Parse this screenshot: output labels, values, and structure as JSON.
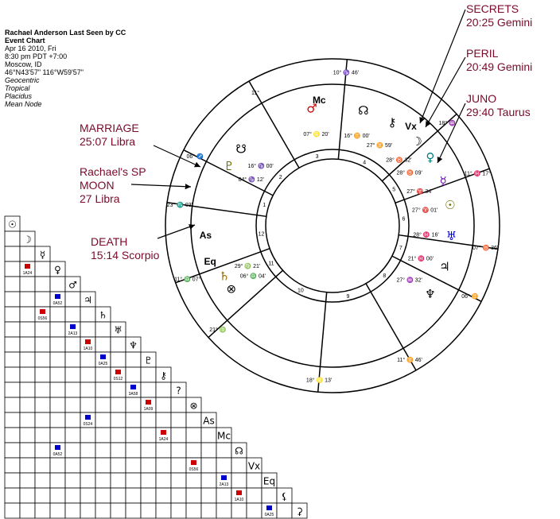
{
  "header": {
    "title": "Rachael Anderson Last Seen by CC",
    "chart_type": "Event Chart",
    "date": "Apr 16 2010, Fri",
    "time": "8:30 pm  PDT +7:00",
    "place": "Moscow, ID",
    "coords": "46°N43'57\"  116°W59'57\"",
    "settings": [
      "Geocentric",
      "Tropical",
      "Placidus",
      "Mean Node"
    ]
  },
  "annotations": {
    "secrets": [
      "SECRETS",
      "20:25 Gemini"
    ],
    "peril": [
      "PERIL",
      "20:49 Gemini"
    ],
    "juno": [
      "JUNO",
      "29:40 Taurus"
    ],
    "marriage": [
      "MARRIAGE",
      "25:07 Libra"
    ],
    "sp_moon": [
      "Rachael's SP",
      "MOON",
      "27 Libra"
    ],
    "death": [
      "DEATH",
      "15:14 Scorpio"
    ]
  },
  "wheel": {
    "house_numbers": [
      "1",
      "2",
      "3",
      "4",
      "5",
      "6",
      "7",
      "8",
      "9",
      "10",
      "11",
      "12"
    ],
    "cusp_labels": [
      {
        "deg": "23°",
        "sign": "♏",
        "min": "03'"
      },
      {
        "deg": "06°",
        "sign": "♐",
        "min": ""
      },
      {
        "deg": "11°",
        "sign": "",
        "min": ""
      },
      {
        "deg": "10°",
        "sign": "♑",
        "min": "46'"
      },
      {
        "deg": "18°",
        "sign": "♒",
        "min": ""
      },
      {
        "deg": "11°",
        "sign": "♓",
        "min": "17°"
      },
      {
        "deg": "07°",
        "sign": "♉",
        "min": "36'"
      },
      {
        "deg": "06°",
        "sign": "♊",
        "min": ""
      },
      {
        "deg": "11°",
        "sign": "♊",
        "min": "46'"
      },
      {
        "deg": "18°",
        "sign": "♌",
        "min": "13'"
      },
      {
        "deg": "21°",
        "sign": "♍",
        "min": ""
      },
      {
        "deg": "11°",
        "sign": "♎",
        "min": "07°"
      }
    ],
    "planets": [
      {
        "glyph": "♂",
        "pos": "07° ♌ 20'",
        "color": "#cc0000"
      },
      {
        "glyph": "☊",
        "pos": "16° ♊ 00'",
        "color": "#000000"
      },
      {
        "glyph": "⚷",
        "pos": "27° ♊ 59'",
        "color": "#000000"
      },
      {
        "glyph": "☽",
        "pos": "28° ♉ 32'",
        "color": "#000000"
      },
      {
        "glyph": "♀",
        "pos": "28° ♉ 09'",
        "color": "#008080"
      },
      {
        "glyph": "☿",
        "pos": "27° ♈ 34'",
        "color": "#6a0dad"
      },
      {
        "glyph": "☉",
        "pos": "27° ♈ 01'",
        "color": "#6b6b00"
      },
      {
        "glyph": "♅",
        "pos": "28° ♓ 16'",
        "color": "#0000cc"
      },
      {
        "glyph": "♃",
        "pos": "21° ♓ 00'",
        "color": "#000000"
      },
      {
        "glyph": "♆",
        "pos": "27° ♒ 32'",
        "color": "#000000"
      },
      {
        "glyph": "♇",
        "pos": "04° ♑ 12'",
        "color": "#6b6b00"
      },
      {
        "glyph": "☋",
        "pos": "16° ♑ 00'",
        "color": "#000000"
      },
      {
        "glyph": "♄",
        "pos": "29° ♍ 21'",
        "color": "#996600"
      },
      {
        "glyph": "⊗",
        "pos": "06° ♎ 04'",
        "color": "#000000"
      }
    ],
    "points": [
      {
        "glyph": "Mc",
        "pos": "13° ♌ 18'"
      },
      {
        "glyph": "Vx",
        "pos": "15° ♊"
      },
      {
        "glyph": "As",
        "pos": "07° ♏ 36'"
      },
      {
        "glyph": "Eq",
        "pos": "23° ♏ 03'"
      }
    ]
  },
  "aspect_grid": {
    "rows": [
      "☉",
      "☽",
      "☿",
      "♀",
      "♂",
      "♃",
      "♄",
      "♅",
      "♆",
      "♇",
      "⚷",
      "?",
      "⊗",
      "As",
      "Mc",
      "☊",
      "Vx",
      "Eq",
      "⚸",
      "⚳"
    ],
    "sample_orbs": [
      "1A24",
      "0A52",
      "0S56",
      "2A13",
      "1A10",
      "0A25",
      "0S12",
      "3A58",
      "1A09",
      "0S24"
    ]
  },
  "colors": {
    "annotation": "#7a0a2a",
    "aspect_red": "#cc0000",
    "aspect_blue": "#0000cc"
  }
}
